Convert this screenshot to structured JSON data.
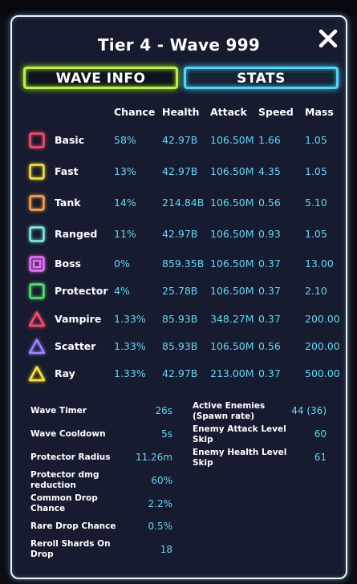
{
  "title": "Tier 4 - Wave 999",
  "tabs": {
    "wave_info": "WAVE INFO",
    "stats": "STATS"
  },
  "columns": [
    "Chance",
    "Health",
    "Attack",
    "Speed",
    "Mass"
  ],
  "enemies": [
    {
      "name": "Basic",
      "shape": "square",
      "color": "#ff4a6a",
      "chance": "58%",
      "health": "42.97B",
      "attack": "106.50M",
      "speed": "1.66",
      "mass": "1.05"
    },
    {
      "name": "Fast",
      "shape": "square",
      "color": "#ffe534",
      "chance": "13%",
      "health": "42.97B",
      "attack": "106.50M",
      "speed": "4.35",
      "mass": "1.05"
    },
    {
      "name": "Tank",
      "shape": "square",
      "color": "#ffa646",
      "chance": "14%",
      "health": "214.84B",
      "attack": "106.50M",
      "speed": "0.56",
      "mass": "5.10"
    },
    {
      "name": "Ranged",
      "shape": "square",
      "color": "#7ff0ea",
      "chance": "11%",
      "health": "42.97B",
      "attack": "106.50M",
      "speed": "0.93",
      "mass": "1.05"
    },
    {
      "name": "Boss",
      "shape": "square-double",
      "color": "#f070ff",
      "chance": "0%",
      "health": "859.35B",
      "attack": "106.50M",
      "speed": "0.37",
      "mass": "13.00"
    },
    {
      "name": "Protector",
      "shape": "square",
      "color": "#50e870",
      "chance": "4%",
      "health": "25.78B",
      "attack": "106.50M",
      "speed": "0.37",
      "mass": "2.10"
    },
    {
      "name": "Vampire",
      "shape": "triangle",
      "color": "#ff4a6a",
      "chance": "1.33%",
      "health": "85.93B",
      "attack": "348.27M",
      "speed": "0.37",
      "mass": "200.00"
    },
    {
      "name": "Scatter",
      "shape": "triangle",
      "color": "#9a86ff",
      "chance": "1.33%",
      "health": "85.93B",
      "attack": "106.50M",
      "speed": "0.56",
      "mass": "200.00"
    },
    {
      "name": "Ray",
      "shape": "triangle",
      "color": "#ffe534",
      "chance": "1.33%",
      "health": "42.97B",
      "attack": "213.00M",
      "speed": "0.37",
      "mass": "500.00"
    }
  ],
  "left_stats": [
    {
      "label": "Wave Timer",
      "value": "26s"
    },
    {
      "label": "Wave Cooldown",
      "value": "5s"
    },
    {
      "label": "Protector Radius",
      "value": "11.26m"
    },
    {
      "label": "Protector dmg reduction",
      "value": "60%"
    },
    {
      "label": "Common Drop Chance",
      "value": "2.2%"
    },
    {
      "label": "Rare Drop Chance",
      "value": "0.5%"
    },
    {
      "label": "Reroll Shards On Drop",
      "value": "18"
    }
  ],
  "right_stats": [
    {
      "label": "Active Enemies (Spawn rate)",
      "value": "44 (36)"
    },
    {
      "label": "Enemy Attack Level Skip",
      "value": "60"
    },
    {
      "label": "Enemy Health Level Skip",
      "value": "61"
    }
  ],
  "colors": {
    "accent_value": "#5fd8f5",
    "tab_wave": "#b8f23a",
    "tab_stats": "#57d3f2",
    "panel_bg": "#171b2f"
  },
  "icons": {
    "close": "close-icon"
  }
}
